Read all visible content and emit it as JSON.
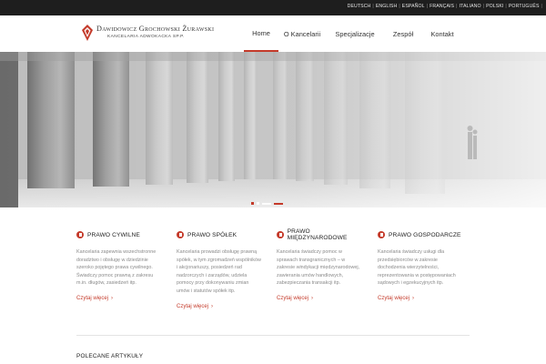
{
  "top_bar": {
    "languages": [
      "DEUTSCH",
      "ENGLISH",
      "ESPAÑOL",
      "FRANÇAIS",
      "ITALIANO",
      "POLSKI",
      "PORTUGUÊS"
    ],
    "separator": "|",
    "tail": "|"
  },
  "brand": {
    "name": "Dawidowicz Grochowski Żurawski",
    "subtitle": "KANCELARIA ADWOKACKA SP.P.",
    "logo_icon": "shield-crest-icon",
    "accent_color": "#c43a2a"
  },
  "nav": {
    "items": [
      {
        "label": "Home",
        "active": true
      },
      {
        "label": "O Kancelarii",
        "active": false
      },
      {
        "label": "Specjalizacje",
        "active": false
      },
      {
        "label": "Zespół",
        "active": false
      },
      {
        "label": "Kontakt",
        "active": false
      }
    ]
  },
  "hero": {
    "image": "colonnade-photo",
    "slider": {
      "count": 4,
      "active_index": 0
    }
  },
  "services": [
    {
      "icon": "document-icon",
      "title": "PRAWO CYWILNE",
      "lines": [
        "Kancelaria zapewnia wszechstronne",
        "doradztwo i obsługę w dziedzinie",
        "szeroko pojętego prawa cywilnego.",
        "Świadczy pomoc prawną z zakresu",
        "m.in. długów, zasiedzeń itp."
      ],
      "link": "Czytaj więcej"
    },
    {
      "icon": "document-icon",
      "title": "PRAWO SPÓŁEK",
      "lines": [
        "Kancelaria prowadzi obsługę prawną",
        "spółek, w tym zgromadzeń wspólników",
        "i akcjonariuszy, posiedzeń rad",
        "nadzorczych i zarządów, udziela",
        "pomocy przy dokonywaniu zmian",
        "umów i statutów spółek itp."
      ],
      "link": "Czytaj więcej"
    },
    {
      "icon": "document-icon",
      "title": "PRAWO MIĘDZYNARODOWE",
      "lines": [
        "Kancelaria świadczy pomoc w",
        "sprawach transgranicznych – w",
        "zakresie windykacji międzynarodowej,",
        "zawierania umów handlowych,",
        "zabezpieczania transakcji itp."
      ],
      "link": "Czytaj więcej"
    },
    {
      "icon": "document-icon",
      "title": "PRAWO GOSPODARCZE",
      "lines": [
        "Kancelaria świadczy usługi dla",
        "przedsiębiorców w zakresie",
        "dochodzenia wierzytelności,",
        "reprezentowania w postępowaniach",
        "sądowych i egzekucyjnych itp."
      ],
      "link": "Czytaj więcej"
    }
  ],
  "featured": {
    "title": "POLECANE ARTYKUŁY"
  }
}
